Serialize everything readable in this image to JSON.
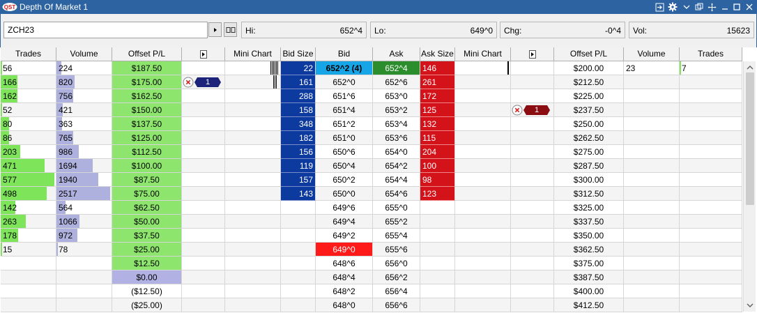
{
  "window": {
    "title": "Depth Of Market 1",
    "logo_text": "QST"
  },
  "toolbar": {
    "symbol": "ZCH23",
    "stats": [
      {
        "label": "Hi:",
        "value": "652^4"
      },
      {
        "label": "Lo:",
        "value": "649^0"
      },
      {
        "label": "Chg:",
        "value": "-0^4"
      },
      {
        "label": "Vol:",
        "value": "15623"
      }
    ]
  },
  "columns": [
    "Trades",
    "Volume",
    "Offset P/L",
    "",
    "Mini Chart",
    "Bid Size",
    "Bid",
    "Ask",
    "Ask Size",
    "Mini Chart",
    "",
    "Offset P/L",
    "Volume",
    "Trades"
  ],
  "colors": {
    "trades_bar": "#7ee45a",
    "volume_bar": "#aeb1dd",
    "pl_positive": "#8de56d",
    "pl_zero": "#b1b1e3",
    "bid_size": "#0d3a9f",
    "ask_size": "#d3121a",
    "bid_best": "#16a6e8",
    "ask_best": "#2b8d2b",
    "lo_highlight": "#ff1a1a"
  },
  "rows": [
    {
      "l_trades": "56",
      "l_trades_frac": 0.012,
      "l_vol": "224",
      "l_vol_frac": 0.09,
      "l_pl": "$187.50",
      "bid_size": "22",
      "bid": "652^2 (4)",
      "ask": "652^4",
      "ask_size": "146",
      "r_pl": "$200.00",
      "r_vol": "23",
      "r_trades": "7",
      "bid_best": true,
      "ask_best": true
    },
    {
      "l_trades": "166",
      "l_trades_frac": 0.3,
      "l_vol": "820",
      "l_vol_frac": 0.33,
      "l_pl": "$175.00",
      "bid_size": "161",
      "bid": "652^0",
      "ask": "652^6",
      "ask_size": "261",
      "r_pl": "$212.50",
      "r_vol": "",
      "r_trades": ""
    },
    {
      "l_trades": "162",
      "l_trades_frac": 0.3,
      "l_vol": "756",
      "l_vol_frac": 0.3,
      "l_pl": "$162.50",
      "bid_size": "288",
      "bid": "651^6",
      "ask": "653^0",
      "ask_size": "172",
      "r_pl": "$225.00",
      "r_vol": "",
      "r_trades": ""
    },
    {
      "l_trades": "52",
      "l_trades_frac": 0.012,
      "l_vol": "421",
      "l_vol_frac": 0.12,
      "l_pl": "$150.00",
      "bid_size": "158",
      "bid": "651^4",
      "ask": "653^2",
      "ask_size": "125",
      "r_pl": "$237.50",
      "r_vol": "",
      "r_trades": ""
    },
    {
      "l_trades": "80",
      "l_trades_frac": 0.15,
      "l_vol": "363",
      "l_vol_frac": 0.1,
      "l_pl": "$137.50",
      "bid_size": "348",
      "bid": "651^2",
      "ask": "653^4",
      "ask_size": "132",
      "r_pl": "$250.00",
      "r_vol": "",
      "r_trades": ""
    },
    {
      "l_trades": "86",
      "l_trades_frac": 0.15,
      "l_vol": "765",
      "l_vol_frac": 0.31,
      "l_pl": "$125.00",
      "bid_size": "182",
      "bid": "651^0",
      "ask": "653^6",
      "ask_size": "115",
      "r_pl": "$262.50",
      "r_vol": "",
      "r_trades": ""
    },
    {
      "l_trades": "203",
      "l_trades_frac": 0.35,
      "l_vol": "986",
      "l_vol_frac": 0.4,
      "l_pl": "$112.50",
      "bid_size": "156",
      "bid": "650^6",
      "ask": "654^0",
      "ask_size": "204",
      "r_pl": "$275.00",
      "r_vol": "",
      "r_trades": ""
    },
    {
      "l_trades": "471",
      "l_trades_frac": 0.8,
      "l_vol": "1694",
      "l_vol_frac": 0.66,
      "l_pl": "$100.00",
      "bid_size": "119",
      "bid": "650^4",
      "ask": "654^2",
      "ask_size": "100",
      "r_pl": "$287.50",
      "r_vol": "",
      "r_trades": ""
    },
    {
      "l_trades": "577",
      "l_trades_frac": 0.97,
      "l_vol": "1940",
      "l_vol_frac": 0.76,
      "l_pl": "$87.50",
      "bid_size": "157",
      "bid": "650^2",
      "ask": "654^4",
      "ask_size": "98",
      "r_pl": "$300.00",
      "r_vol": "",
      "r_trades": ""
    },
    {
      "l_trades": "498",
      "l_trades_frac": 0.84,
      "l_vol": "2517",
      "l_vol_frac": 0.98,
      "l_pl": "$75.00",
      "bid_size": "143",
      "bid": "650^0",
      "ask": "654^6",
      "ask_size": "123",
      "r_pl": "$312.50",
      "r_vol": "",
      "r_trades": ""
    },
    {
      "l_trades": "142",
      "l_trades_frac": 0.27,
      "l_vol": "564",
      "l_vol_frac": 0.17,
      "l_pl": "$62.50",
      "bid_size": "",
      "bid": "649^6",
      "ask": "655^0",
      "ask_size": "",
      "r_pl": "$325.00",
      "r_vol": "",
      "r_trades": ""
    },
    {
      "l_trades": "263",
      "l_trades_frac": 0.45,
      "l_vol": "1066",
      "l_vol_frac": 0.42,
      "l_pl": "$50.00",
      "bid_size": "",
      "bid": "649^4",
      "ask": "655^2",
      "ask_size": "",
      "r_pl": "$337.50",
      "r_vol": "",
      "r_trades": ""
    },
    {
      "l_trades": "178",
      "l_trades_frac": 0.32,
      "l_vol": "972",
      "l_vol_frac": 0.38,
      "l_pl": "$37.50",
      "bid_size": "",
      "bid": "649^2",
      "ask": "655^4",
      "ask_size": "",
      "r_pl": "$350.00",
      "r_vol": "",
      "r_trades": ""
    },
    {
      "l_trades": "15",
      "l_trades_frac": 0.012,
      "l_vol": "78",
      "l_vol_frac": 0.01,
      "l_pl": "$25.00",
      "bid_size": "",
      "bid": "649^0",
      "ask": "655^6",
      "ask_size": "",
      "r_pl": "$362.50",
      "r_vol": "",
      "r_trades": "",
      "bid_lo": true
    },
    {
      "l_trades": "",
      "l_trades_frac": 0,
      "l_vol": "",
      "l_vol_frac": 0,
      "l_pl": "$12.50",
      "bid_size": "",
      "bid": "648^6",
      "ask": "656^0",
      "ask_size": "",
      "r_pl": "$375.00",
      "r_vol": "",
      "r_trades": ""
    },
    {
      "l_trades": "",
      "l_trades_frac": 0,
      "l_vol": "",
      "l_vol_frac": 0,
      "l_pl": "$0.00",
      "bid_size": "",
      "bid": "648^4",
      "ask": "656^2",
      "ask_size": "",
      "r_pl": "$387.50",
      "r_vol": "",
      "r_trades": "",
      "pl_zero": true
    },
    {
      "l_trades": "",
      "l_trades_frac": 0,
      "l_vol": "",
      "l_vol_frac": 0,
      "l_pl": "($12.50)",
      "bid_size": "",
      "bid": "648^2",
      "ask": "656^4",
      "ask_size": "",
      "r_pl": "$400.00",
      "r_vol": "",
      "r_trades": "",
      "pl_neg": true
    },
    {
      "l_trades": "",
      "l_trades_frac": 0,
      "l_vol": "",
      "l_vol_frac": 0,
      "l_pl": "($25.00)",
      "bid_size": "",
      "bid": "648^0",
      "ask": "656^6",
      "ask_size": "",
      "r_pl": "$412.50",
      "r_vol": "",
      "r_trades": "",
      "pl_neg": true
    }
  ],
  "orders": [
    {
      "side": "buy",
      "qty": "1",
      "row": 1,
      "color": "#1d237a"
    },
    {
      "side": "sell",
      "qty": "1",
      "row": 3,
      "color": "#8b0d12"
    }
  ]
}
